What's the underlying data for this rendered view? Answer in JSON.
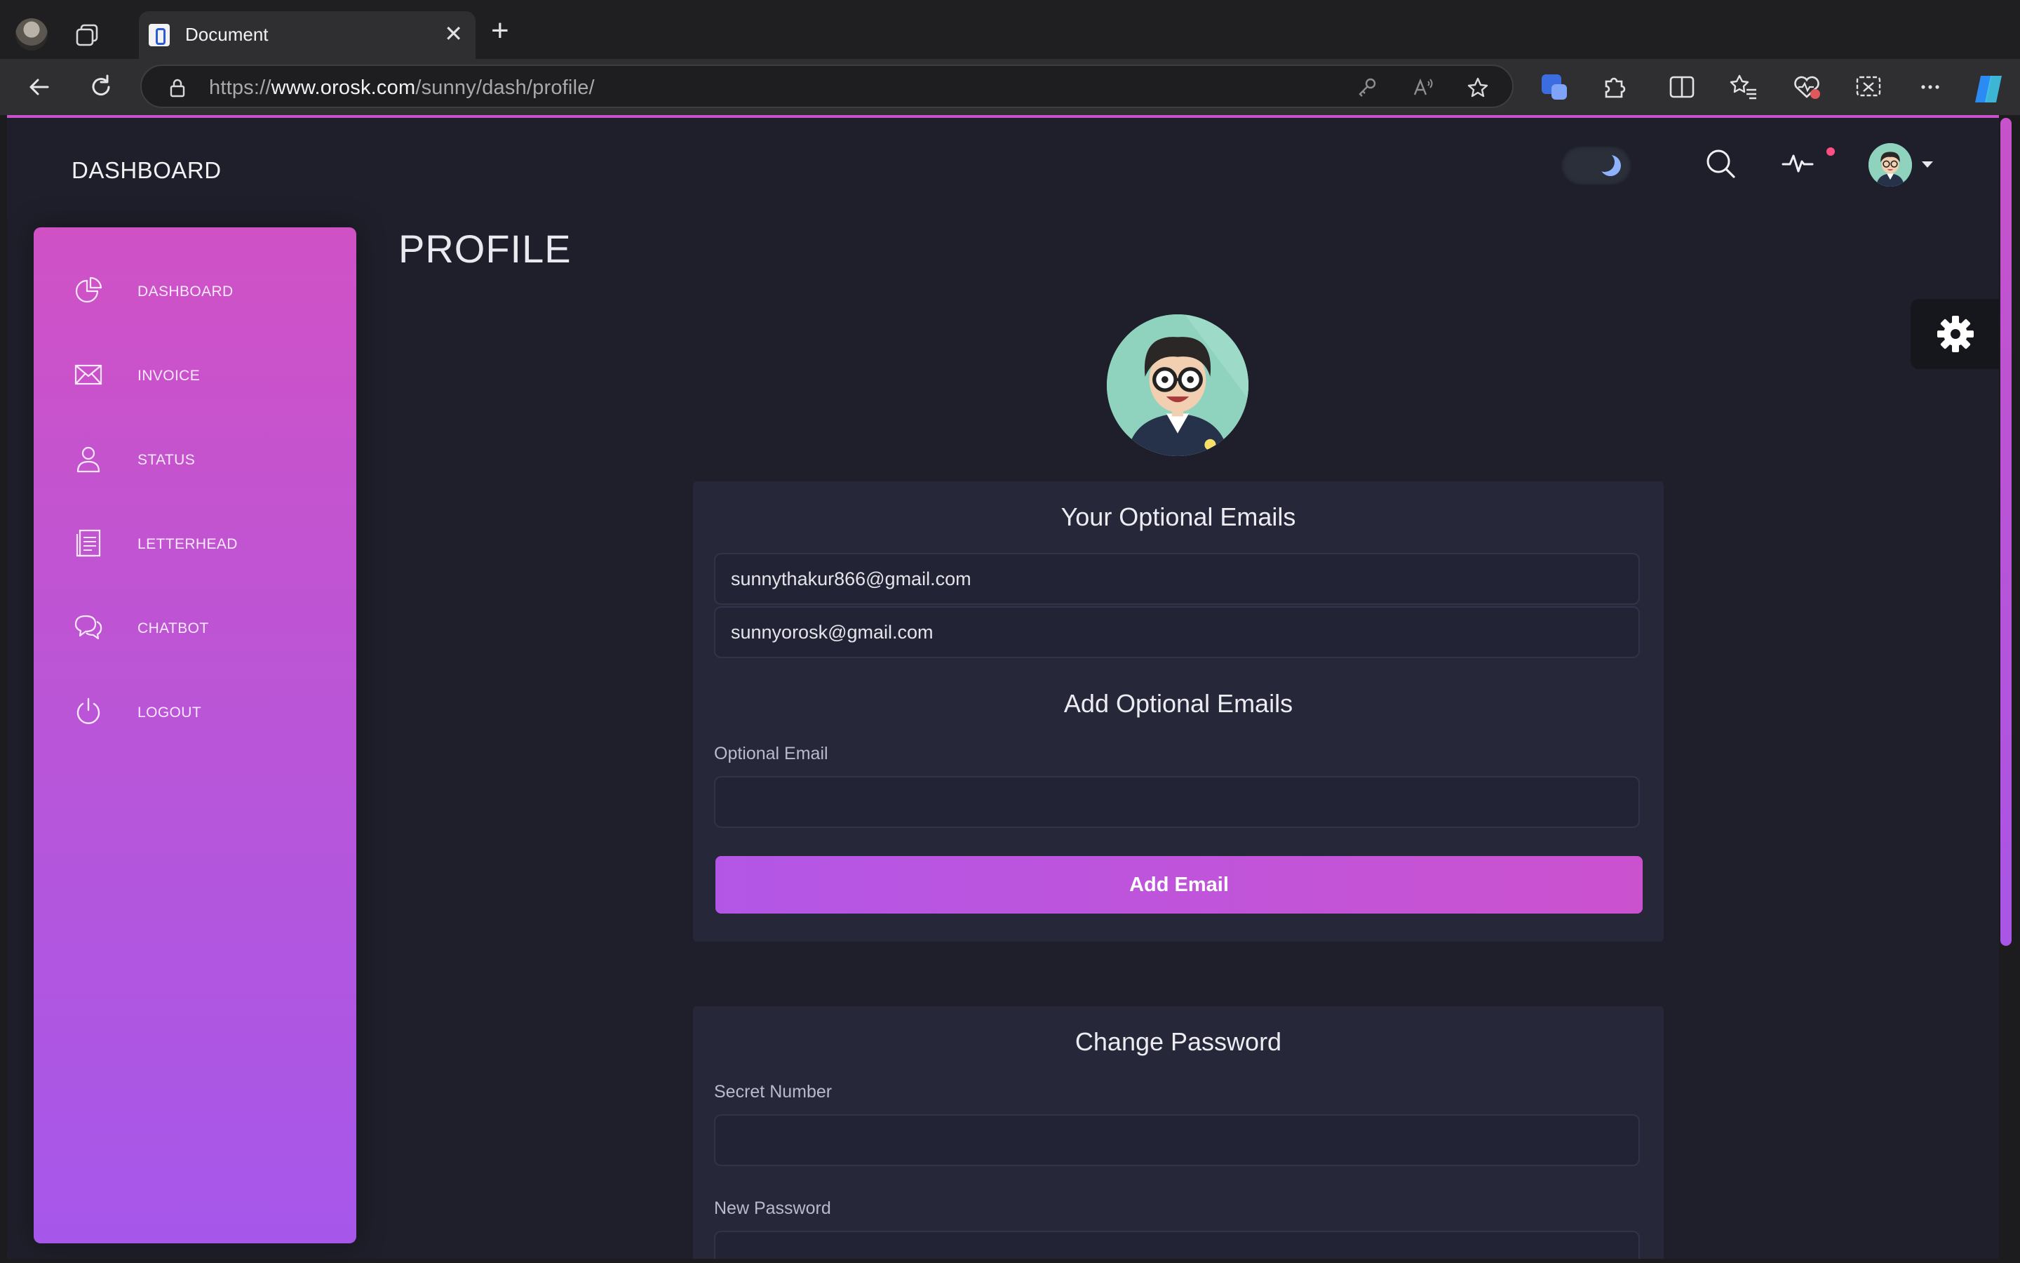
{
  "browser": {
    "tab_title": "Document",
    "close_glyph": "✕",
    "new_tab_glyph": "+",
    "url_scheme": "https://",
    "url_host": "www.orosk.com",
    "url_path": "/sunny/dash/profile/"
  },
  "header": {
    "title": "DASHBOARD",
    "icons": [
      "moon-icon",
      "search-icon",
      "activity-icon",
      "avatar",
      "chevron-down-icon"
    ],
    "notification_color": "#ff4f82"
  },
  "sidebar": {
    "gradient": [
      "#d051c6",
      "#a657ea"
    ],
    "items": [
      {
        "label": "DASHBOARD",
        "icon": "pie-chart-icon"
      },
      {
        "label": "INVOICE",
        "icon": "envelope-icon"
      },
      {
        "label": "STATUS",
        "icon": "user-icon"
      },
      {
        "label": "LETTERHEAD",
        "icon": "document-icon"
      },
      {
        "label": "CHATBOT",
        "icon": "chat-icon"
      },
      {
        "label": "LOGOUT",
        "icon": "power-icon"
      }
    ]
  },
  "main": {
    "page_title": "PROFILE",
    "optional_emails": {
      "heading": "Your Optional Emails",
      "emails": [
        "sunnythakur866@gmail.com",
        "sunnyorosk@gmail.com"
      ]
    },
    "add_email": {
      "heading": "Add Optional Emails",
      "field_label": "Optional Email",
      "field_value": "",
      "button_label": "Add Email"
    },
    "change_password": {
      "heading": "Change Password",
      "secret_label": "Secret Number",
      "new_password_label": "New Password"
    },
    "settings_icon": "gear-icon"
  },
  "colors": {
    "accent": "#c752c9",
    "page_bg": "#1f1f2b",
    "card_bg": "#262738"
  }
}
